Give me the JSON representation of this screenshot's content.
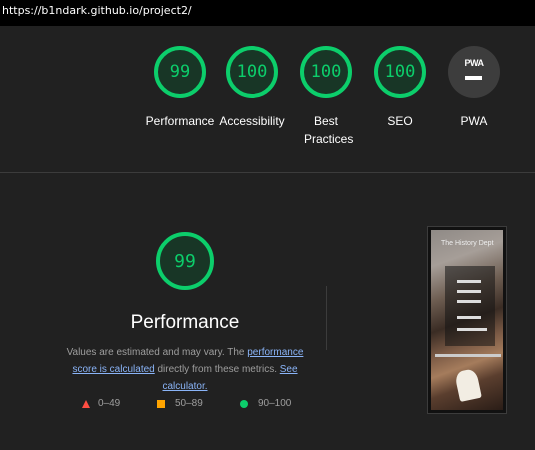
{
  "browser": {
    "url": "https://b1ndark.github.io/project2/"
  },
  "summary": {
    "gauges": [
      {
        "score": "99",
        "label": "Performance"
      },
      {
        "score": "100",
        "label": "Accessibility"
      },
      {
        "score": "100",
        "label": "Best Practices"
      },
      {
        "score": "100",
        "label": "SEO"
      }
    ],
    "pwa": {
      "badge_text": "PWA",
      "label": "PWA"
    }
  },
  "performance": {
    "score": "99",
    "title": "Performance",
    "note": {
      "text_1": "Values are estimated and may vary. The ",
      "link_1": "performance score is calculated",
      "text_2": " directly from these metrics. ",
      "link_2": "See calculator."
    },
    "legend": {
      "fail": "0–49",
      "average": "50–89",
      "pass": "90–100"
    }
  },
  "screenshot": {
    "title": "The History Dept"
  },
  "colors": {
    "pass": "#0cce6b",
    "average": "#ffa400",
    "fail": "#ff4e42",
    "link": "#8ab4f8",
    "background": "#212121"
  }
}
